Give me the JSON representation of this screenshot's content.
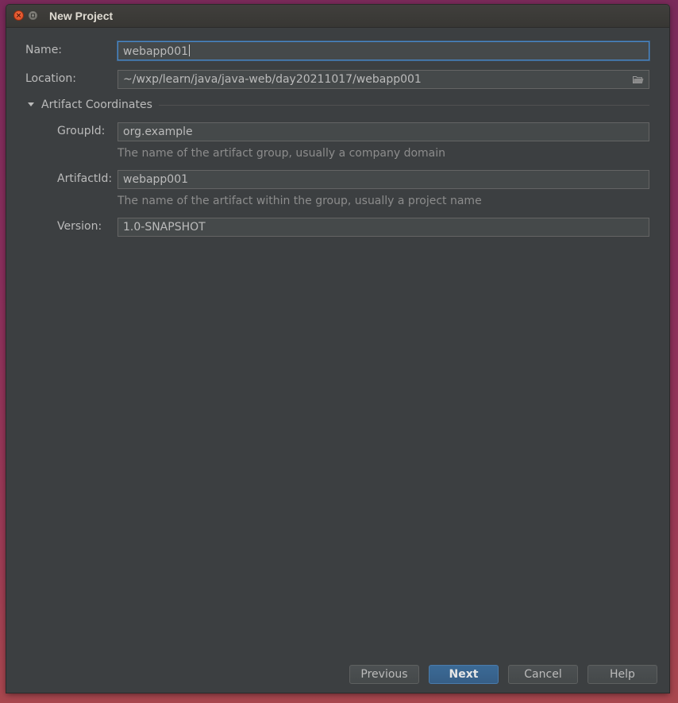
{
  "window": {
    "title": "New Project",
    "close_glyph": "×"
  },
  "form": {
    "name_label": "Name:",
    "name_value": "webapp001",
    "location_label": "Location:",
    "location_value": "~/wxp/learn/java/java-web/day20211017/webapp001"
  },
  "artifact": {
    "section_title": "Artifact Coordinates",
    "groupid_label": "GroupId:",
    "groupid_value": "org.example",
    "groupid_hint": "The name of the artifact group, usually a company domain",
    "artifactid_label": "ArtifactId:",
    "artifactid_value": "webapp001",
    "artifactid_hint": "The name of the artifact within the group, usually a project name",
    "version_label": "Version:",
    "version_value": "1.0-SNAPSHOT"
  },
  "buttons": {
    "previous": "Previous",
    "next": "Next",
    "cancel": "Cancel",
    "help": "Help"
  },
  "colors": {
    "accent": "#4a88c7",
    "primary_button": "#365e86",
    "background": "#3c3f41"
  },
  "icons": {
    "close": "close-icon",
    "minimize": "minimize-icon",
    "browse": "folder-icon",
    "section_toggle": "chevron-down-icon"
  }
}
